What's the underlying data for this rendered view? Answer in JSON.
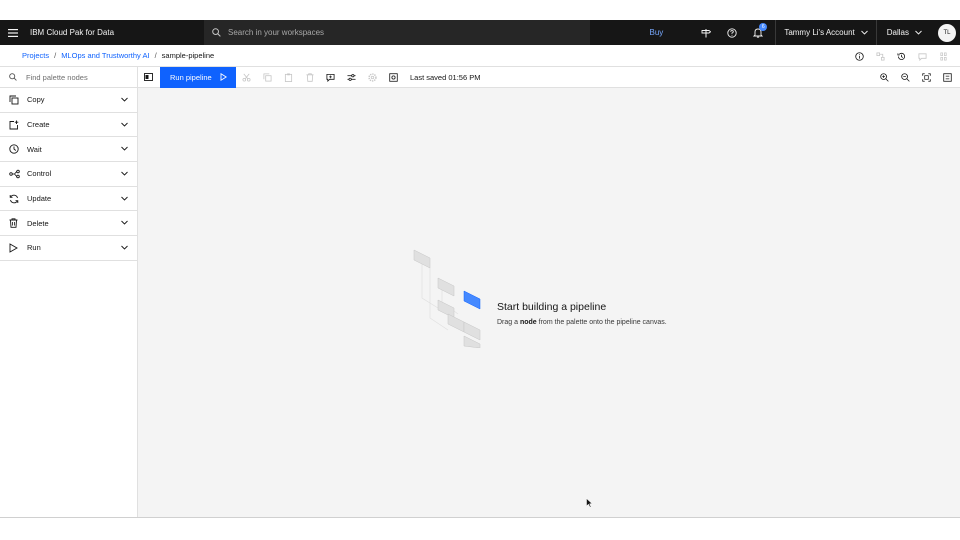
{
  "header": {
    "brand": "IBM Cloud Pak for Data",
    "search_placeholder": "Search in your workspaces",
    "buy_label": "Buy",
    "notification_count": "6",
    "account_label": "Tammy Li's Account",
    "region_label": "Dallas",
    "avatar_initials": "TL"
  },
  "breadcrumb": {
    "items": [
      "Projects",
      "MLOps and Trustworthy AI"
    ],
    "current": "sample-pipeline"
  },
  "palette": {
    "search_placeholder": "Find palette nodes",
    "items": [
      {
        "label": "Copy",
        "icon": "copy-icon"
      },
      {
        "label": "Create",
        "icon": "create-icon"
      },
      {
        "label": "Wait",
        "icon": "clock-icon"
      },
      {
        "label": "Control",
        "icon": "control-icon"
      },
      {
        "label": "Update",
        "icon": "refresh-icon"
      },
      {
        "label": "Delete",
        "icon": "trash-icon"
      },
      {
        "label": "Run",
        "icon": "play-icon"
      }
    ]
  },
  "toolbar": {
    "run_label": "Run pipeline",
    "last_saved": "Last saved 01:56 PM"
  },
  "canvas": {
    "empty_title": "Start building a pipeline",
    "empty_desc_before": "Drag a ",
    "empty_desc_bold": "node",
    "empty_desc_after": " from the palette onto the pipeline canvas."
  },
  "colors": {
    "accent": "#0f62fe",
    "header_bg": "#161616",
    "link": "#0f62fe"
  }
}
